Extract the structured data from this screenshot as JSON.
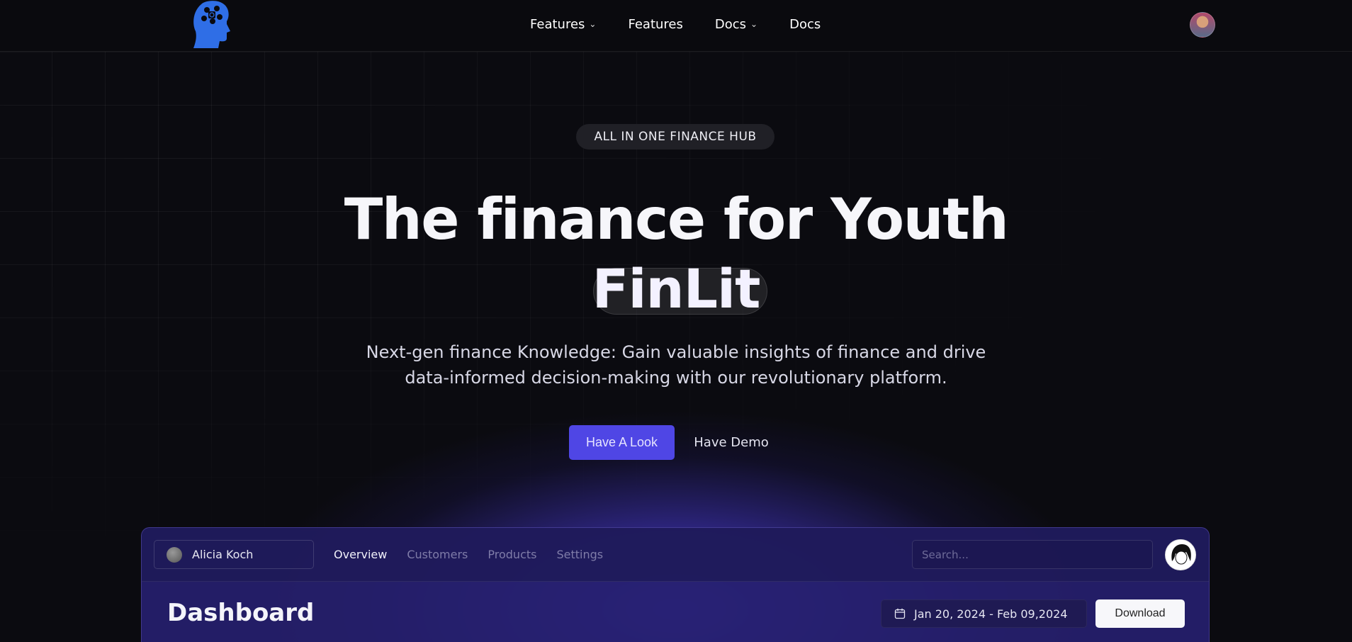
{
  "nav": {
    "items": [
      {
        "label": "Features",
        "has_dropdown": true
      },
      {
        "label": "Features",
        "has_dropdown": false
      },
      {
        "label": "Docs",
        "has_dropdown": true
      },
      {
        "label": "Docs",
        "has_dropdown": false
      }
    ],
    "dropdown_glyph": "⌄",
    "logo_icon": "brain-head-icon",
    "avatar_icon": "user-avatar"
  },
  "hero": {
    "badge": "ALL IN ONE FINANCE HUB",
    "headline": "The finance for Youth",
    "highlight": "FinLit",
    "subtitle_line1": "Next-gen finance Knowledge: Gain valuable insights of finance and drive",
    "subtitle_line2": "data-informed decision-making with our revolutionary platform.",
    "primary_cta": "Have A Look",
    "secondary_cta": "Have Demo"
  },
  "dashboard": {
    "account_name": "Alicia Koch",
    "tabs": [
      "Overview",
      "Customers",
      "Products",
      "Settings"
    ],
    "active_tab": "Overview",
    "search_placeholder": "Search...",
    "title": "Dashboard",
    "date_range": "Jan 20, 2024 - Feb 09,2024",
    "download_label": "Download"
  },
  "colors": {
    "background": "#0b0b10",
    "accent": "#4f46e5",
    "glow": "#5042f0",
    "logo": "#2f6ee6"
  }
}
